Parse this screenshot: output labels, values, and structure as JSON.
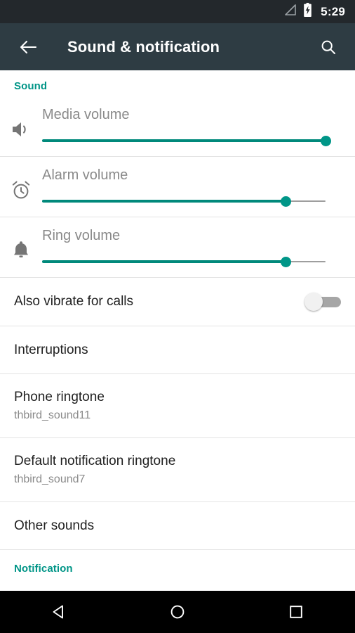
{
  "statusbar": {
    "time": "5:29",
    "signal_icon": "signal-triangle-icon",
    "battery_icon": "battery-charging-icon"
  },
  "actionbar": {
    "back_icon": "back-arrow-icon",
    "title": "Sound & notification",
    "search_icon": "search-icon"
  },
  "colors": {
    "accent_teal": "#009688",
    "section_header_teal": "#009587",
    "actionbar_bg": "#2e3c43",
    "statusbar_bg": "#23282c",
    "navbar_bg": "#000000",
    "primary_text": "#212121",
    "secondary_text": "#8a8a8a",
    "divider": "#e4e4e4",
    "switch_track_off": "#a6a6a6",
    "switch_thumb_off": "#f1f1f1"
  },
  "sections": [
    {
      "label": "Sound"
    },
    {
      "label": "Notification"
    }
  ],
  "sliders": [
    {
      "icon": "speaker-volume-icon",
      "label": "Media volume",
      "value_percent": 100,
      "fill_width": "100%",
      "thumb_left": "100%"
    },
    {
      "icon": "alarm-clock-icon",
      "label": "Alarm volume",
      "value_percent": 86,
      "fill_width": "86%",
      "thumb_left": "86%"
    },
    {
      "icon": "bell-icon",
      "label": "Ring volume",
      "value_percent": 86,
      "fill_width": "86%",
      "thumb_left": "86%"
    }
  ],
  "toggle_row": {
    "title": "Also vibrate for calls",
    "state": "off"
  },
  "list_items": [
    {
      "title": "Interruptions",
      "subtitle": ""
    },
    {
      "title": "Phone ringtone",
      "subtitle": "thbird_sound11"
    },
    {
      "title": "Default notification ringtone",
      "subtitle": "thbird_sound7"
    },
    {
      "title": "Other sounds",
      "subtitle": ""
    }
  ],
  "navbar": {
    "back_label": "back-triangle-icon",
    "home_label": "home-circle-icon",
    "recents_label": "recents-square-icon"
  }
}
